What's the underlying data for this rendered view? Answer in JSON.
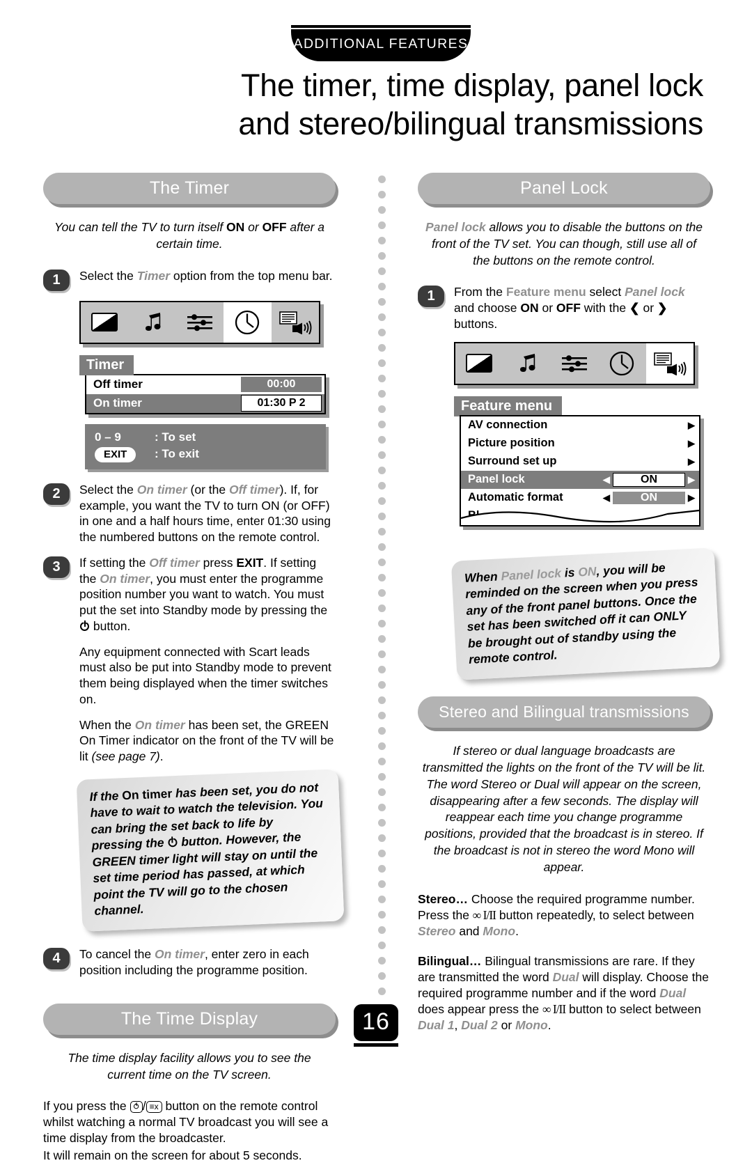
{
  "header": {
    "tab_label": "ADDITIONAL FEATURES",
    "title_line1": "The timer, time display, panel lock",
    "title_line2": "and stereo/bilingual transmissions"
  },
  "page_number": "16",
  "left_column": {
    "timer_section": {
      "heading": "The Timer",
      "intro_a": "You can tell the TV to turn itself ",
      "intro_on": "ON",
      "intro_b": " or ",
      "intro_off": "OFF",
      "intro_c": " after a certain time.",
      "step1": {
        "number": "1",
        "text_a": "Select the ",
        "text_em": "Timer",
        "text_b": " option from the top menu bar."
      },
      "menu_bar_icons": [
        "picture-contrast-icon",
        "sound-note-icon",
        "settings-sliders-icon",
        "clock-timer-icon",
        "teletext-speaker-icon"
      ],
      "menu_bar_active_index": 3,
      "osd": {
        "title": "Timer",
        "rows": [
          {
            "label": "Off timer",
            "value": "00:00",
            "selected": false
          },
          {
            "label": "On timer",
            "value": "01:30  P 2",
            "selected": true
          }
        ],
        "help": [
          {
            "key": "0 – 9",
            "action": ": To set"
          },
          {
            "key": "EXIT",
            "action": ": To exit"
          }
        ]
      },
      "step2": {
        "number": "2",
        "p1": "Select the ",
        "em1": "On timer",
        "p2": " (or the ",
        "em2": "Off timer",
        "p3": "). If, for example, you want the TV to turn ON (or OFF) in one and a half hours time, enter 01:30 using the numbered buttons on the remote control."
      },
      "step3": {
        "number": "3",
        "p1": "If setting the ",
        "em1": "Off timer",
        "p2": " press ",
        "b1": "EXIT",
        "p3": ". If setting the ",
        "em2": "On timer",
        "p4": ", you must enter the programme position number you want to watch. You must put the set into Standby mode by pressing the ",
        "p5": " button."
      },
      "para_scart": "Any equipment connected with Scart leads must also be put into Standby mode to prevent them being displayed when the timer switches on.",
      "para_green_a": "When the ",
      "para_green_em": "On timer",
      "para_green_b": " has been set, the GREEN On Timer indicator on the front of the TV will be lit ",
      "para_green_ital": "(see page 7)",
      "para_green_c": ".",
      "note": {
        "a": "If the ",
        "b_bold": "On timer",
        "c": " has been set, you do not have to wait to watch the television. You can bring the set back to life by pressing the ",
        "d": " button. However, the GREEN timer light will stay on until the set time period has passed, at which point the TV will go to the chosen channel."
      },
      "step4": {
        "number": "4",
        "p1": "To cancel the ",
        "em1": "On timer",
        "p2": ", enter zero in each position including the programme position."
      }
    },
    "time_display_section": {
      "heading": "The Time Display",
      "intro": "The time display facility allows you to see the current time on the TV screen.",
      "p1_a": "If you press the ",
      "key1": "⥀",
      "key2": "≡x",
      "p1_b": " button on the remote control whilst watching a normal TV broadcast you will see a time display from the broadcaster.",
      "p2": "It will remain on the screen for about 5 seconds."
    }
  },
  "right_column": {
    "panel_lock_section": {
      "heading": "Panel Lock",
      "intro_em": "Panel lock",
      "intro_rest": " allows you to disable the buttons on the front of the TV set. You can though, still use all of the buttons on the remote control.",
      "step1": {
        "number": "1",
        "p1": "From the ",
        "em1": "Feature menu",
        "p2": " select ",
        "em2": "Panel lock",
        "p3": "and choose ",
        "b_on": "ON",
        "p4": " or ",
        "b_off": "OFF",
        "p5": " with the ",
        "arrow_left": "❮",
        "p6": " or ",
        "arrow_right": "❯",
        "p7": " buttons."
      },
      "menu_bar_icons": [
        "picture-contrast-icon",
        "sound-note-icon",
        "settings-sliders-icon",
        "clock-timer-icon",
        "teletext-speaker-icon"
      ],
      "menu_bar_active_index": 4,
      "osd": {
        "title": "Feature menu",
        "rows": [
          {
            "label": "AV connection",
            "value": "",
            "selected": false,
            "submenu": true
          },
          {
            "label": "Picture position",
            "value": "",
            "selected": false,
            "submenu": true
          },
          {
            "label": "Surround set up",
            "value": "",
            "selected": false,
            "submenu": true
          },
          {
            "label": "Panel lock",
            "value": "ON",
            "selected": true,
            "submenu": false
          },
          {
            "label": "Automatic format",
            "value": "ON",
            "selected": false,
            "submenu": false
          },
          {
            "label": "Bl",
            "value": "",
            "selected": false,
            "submenu": false
          }
        ]
      },
      "note": {
        "a": "When ",
        "b_gray": "Panel lock",
        "c": " is ",
        "d_gray": "ON",
        "e": ", you will be reminded on the screen when you press any of the front panel buttons. Once the set has been switched off it can ONLY be brought out of standby using the remote control."
      }
    },
    "stereo_section": {
      "heading": "Stereo and Bilingual transmissions",
      "intro": "If stereo or dual language broadcasts are transmitted the lights on the front of the TV will be lit. The word Stereo or Dual will appear on the screen, disappearing after a few seconds. The display will reappear each time you change programme positions, provided that the broadcast is in stereo. If the broadcast is not in stereo the word Mono will appear.",
      "stereo_para": {
        "lead": "Stereo…",
        "p1": " Choose the required programme number. Press the ",
        "key": "∞ I/II",
        "p2": " button repeatedly, to select between ",
        "em1": "Stereo",
        "p3": " and ",
        "em2": "Mono",
        "p4": "."
      },
      "bilingual_para": {
        "lead": "Bilingual…",
        "p1": " Bilingual transmissions are rare. If they are transmitted the word ",
        "em1": "Dual",
        "p2": " will display. Choose the required programme number and if the word ",
        "em2": "Dual",
        "p3": " does appear press the ",
        "key": "∞ I/II",
        "p4": " button to select between ",
        "em3": "Dual 1",
        "p5": ", ",
        "em4": "Dual 2",
        "p6": " or ",
        "em5": "Mono",
        "p7": "."
      }
    }
  },
  "colors": {
    "pill_gray": "#b3b3b3",
    "osd_gray": "#7d7d7d",
    "step_dark": "#3b3b3b",
    "dot_gray": "#c2c2c2"
  }
}
